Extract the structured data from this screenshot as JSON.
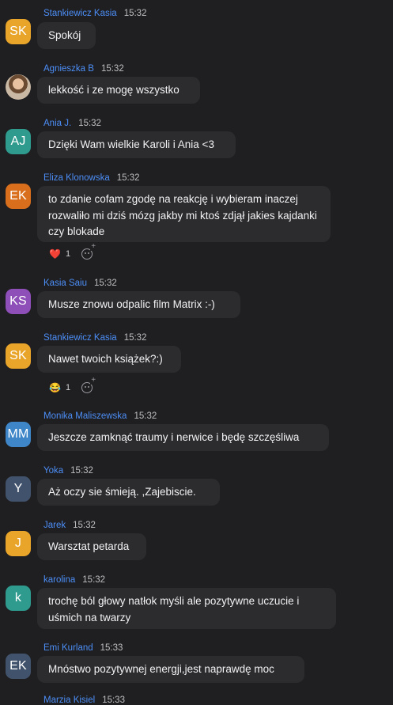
{
  "messages": [
    {
      "name": "Stankiewicz Kasia",
      "time": "15:32",
      "initials": "SK",
      "avatar_color": "#e9a42a",
      "text": "Spokój"
    },
    {
      "name": "Agnieszka B",
      "time": "15:32",
      "initials": "",
      "avatar_color": "#b89a7a",
      "text": "lekkość i ze mogę wszystko"
    },
    {
      "name": "Ania J.",
      "time": "15:32",
      "initials": "AJ",
      "avatar_color": "#2f9b8f",
      "text": "Dzięki Wam wielkie Karoli i Ania <3"
    },
    {
      "name": "Eliza Klonowska",
      "time": "15:32",
      "initials": "EK",
      "avatar_color": "#d96f1c",
      "text": "to zdanie cofam zgodę na reakcję i wybieram inaczej rozwaliło mi dziś mózg jakby mi ktoś zdjął jakies kajdanki czy blokade",
      "reaction": {
        "emoji": "❤️",
        "count": "1"
      }
    },
    {
      "name": "Kasia Saiu",
      "time": "15:32",
      "initials": "KS",
      "avatar_color": "#8e4fb8",
      "text": "Musze znowu odpalic film Matrix :-)"
    },
    {
      "name": "Stankiewicz Kasia",
      "time": "15:32",
      "initials": "SK",
      "avatar_color": "#e9a42a",
      "text": "Nawet twoich książek?:)",
      "reaction": {
        "emoji": "😂",
        "count": "1"
      }
    },
    {
      "name": "Monika Maliszewska",
      "time": "15:32",
      "initials": "MM",
      "avatar_color": "#3f86c9",
      "text": "Jeszcze zamknąć traumy i nerwice i będę szczęśliwa"
    },
    {
      "name": "Yoka",
      "time": "15:32",
      "initials": "Y",
      "avatar_color": "#41536c",
      "text": "Aż oczy sie śmieją. ,Zajebiscie."
    },
    {
      "name": "Jarek",
      "time": "15:32",
      "initials": "J",
      "avatar_color": "#e9a42a",
      "text": "Warsztat petarda"
    },
    {
      "name": "karolina",
      "time": "15:32",
      "initials": "k",
      "avatar_color": "#2f9b8f",
      "text": "trochę ból głowy natłok myśli ale pozytywne uczucie i uśmich na twarzy"
    },
    {
      "name": "Emi Kurland",
      "time": "15:33",
      "initials": "EK",
      "avatar_color": "#41536c",
      "text": "Mnóstwo pozytywnej energji,jest naprawdę moc"
    },
    {
      "name": "Marzia Kisiel",
      "time": "15:33",
      "initials": "",
      "avatar_color": "",
      "text": ""
    }
  ]
}
